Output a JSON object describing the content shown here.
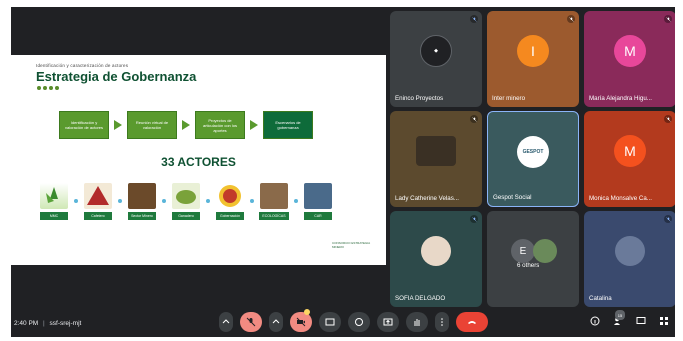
{
  "meeting": {
    "time": "2:40 PM",
    "separator": "|",
    "code": "ssf-srej-mjt"
  },
  "slide": {
    "subtitle": "Identificación y caracterización de actores",
    "title": "Estrategia de Gobernanza",
    "flow": [
      "Identificación y valoración de actores",
      "Reunión virtual de valoración",
      "Proyectos de articulación con los aportes",
      "Escenarios de gobernanza"
    ],
    "count": "33 ACTORES",
    "actors": [
      "MMC",
      "Cafetero",
      "Sector Minero",
      "Ganadero",
      "Gobernación",
      "ECOLOGÍCAS",
      "CAR"
    ],
    "logo_text": "CONSORCIO ESTRATEGIA MINERO"
  },
  "participants": [
    {
      "name": "Eninco Proyectos",
      "initial": "",
      "color": "#3c4043"
    },
    {
      "name": "Inter minero",
      "initial": "I",
      "color": "#f5891f"
    },
    {
      "name": "María Alejandra Higu...",
      "initial": "M",
      "color": "#e8479a"
    },
    {
      "name": "Lady Catherine Velas...",
      "initial": "",
      "color": "#5c4a2e"
    },
    {
      "name": "Gespot Social",
      "initial": "",
      "color": "#3a5a5e"
    },
    {
      "name": "Monica Monsalve Ca...",
      "initial": "M",
      "color": "#f4511e"
    },
    {
      "name": "SOFIA DELGADO",
      "initial": "",
      "color": "#2d4a4a"
    },
    {
      "name": "6 others",
      "initial": "E",
      "color": "#4a4d51"
    },
    {
      "name": "Catalina",
      "initial": "",
      "color": "#3a4a6e"
    }
  ],
  "people_count": "15",
  "gespot_logo": "GESPOT"
}
